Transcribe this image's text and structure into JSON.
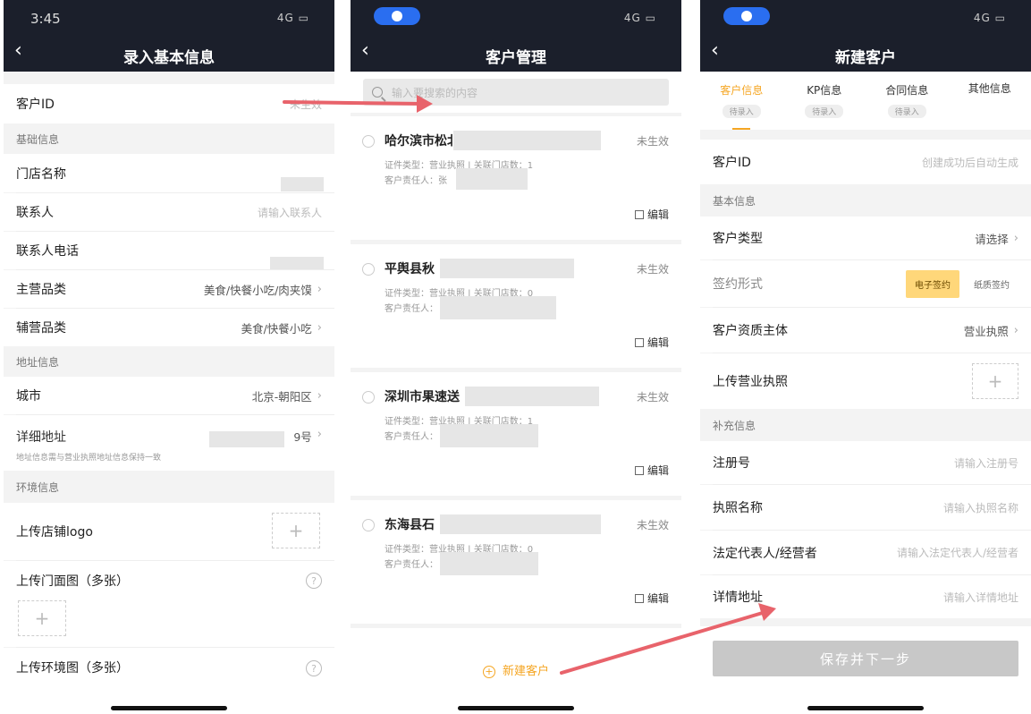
{
  "status": {
    "time": "3:45",
    "network": "4G"
  },
  "screen1": {
    "title": "录入基本信息",
    "customer_id_label": "客户ID",
    "customer_id_value": "未生效",
    "sec_basic": "基础信息",
    "store_name_label": "门店名称",
    "contact_label": "联系人",
    "contact_placeholder": "请输入联系人",
    "phone_label": "联系人电话",
    "main_category_label": "主营品类",
    "main_category_value": "美食/快餐小吃/肉夹馍",
    "sub_category_label": "辅营品类",
    "sub_category_value": "美食/快餐小吃",
    "sec_address": "地址信息",
    "city_label": "城市",
    "city_value": "北京-朝阳区",
    "address_label": "详细地址",
    "address_value": "9号",
    "address_hint": "地址信息需与营业执照地址信息保持一致",
    "sec_env": "环境信息",
    "logo_label": "上传店铺logo",
    "front_label": "上传门面图（多张）",
    "env_label": "上传环境图（多张）"
  },
  "screen2": {
    "title": "客户管理",
    "search_placeholder": "输入要搜索的内容",
    "cards": [
      {
        "name": "哈尔滨市松北",
        "status": "未生效",
        "line1": "证件类型：营业执照 | 关联门店数：1",
        "line2": "客户责任人：张",
        "edit": "编辑"
      },
      {
        "name": "平舆县秋",
        "status": "未生效",
        "line1": "证件类型：营业执照 | 关联门店数：0",
        "line2": "客户责任人：",
        "edit": "编辑"
      },
      {
        "name": "深圳市果速送",
        "status": "未生效",
        "line1": "证件类型：营业执照 | 关联门店数：1",
        "line2": "客户责任人：",
        "edit": "编辑"
      },
      {
        "name": "东海县石",
        "status": "未生效",
        "line1": "证件类型：营业执照 | 关联门店数：0",
        "line2": "客户责任人：",
        "edit": "编辑"
      }
    ],
    "new_customer": "新建客户"
  },
  "screen3": {
    "title": "新建客户",
    "tabs": [
      {
        "label": "客户信息",
        "tag": "待录入"
      },
      {
        "label": "KP信息",
        "tag": "待录入"
      },
      {
        "label": "合同信息",
        "tag": "待录入"
      },
      {
        "label": "其他信息",
        "tag": ""
      }
    ],
    "customer_id_label": "客户ID",
    "customer_id_placeholder": "创建成功后自动生成",
    "sec_basic": "基本信息",
    "type_label": "客户类型",
    "type_value": "请选择",
    "sign_label": "签约形式",
    "sign_on": "电子签约",
    "sign_off": "纸质签约",
    "qual_label": "客户资质主体",
    "qual_value": "营业执照",
    "upload_label": "上传营业执照",
    "sec_extra": "补充信息",
    "reg_label": "注册号",
    "reg_placeholder": "请输入注册号",
    "lic_label": "执照名称",
    "lic_placeholder": "请输入执照名称",
    "legal_label": "法定代表人/经营者",
    "legal_placeholder": "请输入法定代表人/经营者",
    "addr_label": "详情地址",
    "addr_placeholder": "请输入详情地址",
    "save": "保存并下一步"
  },
  "colors": {
    "accent": "#f5a623",
    "nav": "#1b1f2b",
    "arrow": "#e8636b"
  }
}
